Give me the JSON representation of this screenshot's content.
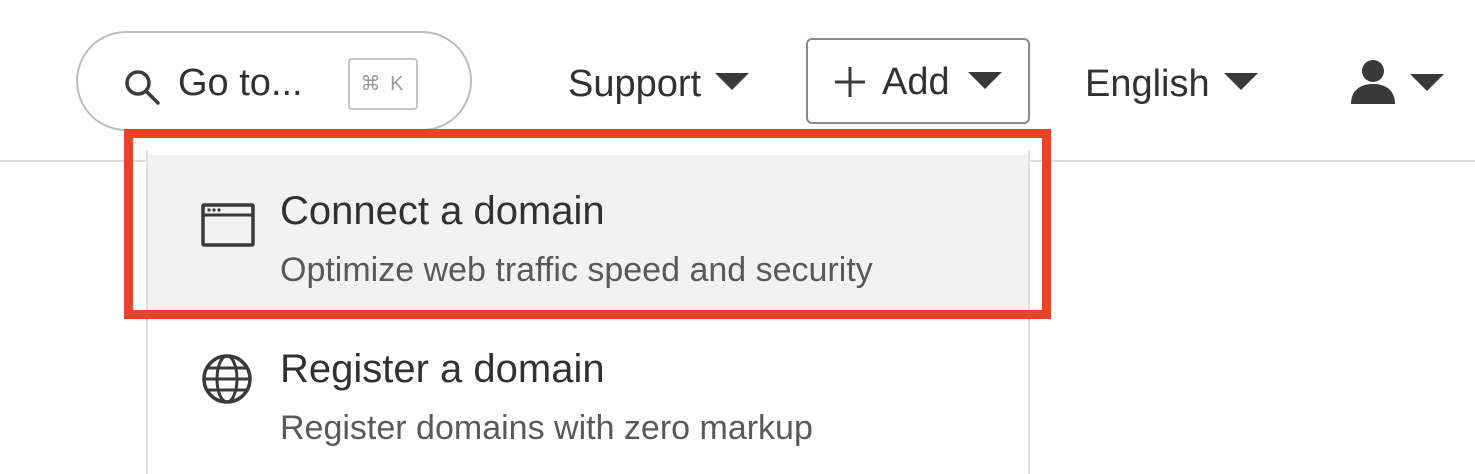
{
  "search": {
    "label": "Go to...",
    "shortcut": "⌘ K",
    "icon": "search-icon"
  },
  "nav": {
    "support_label": "Support",
    "add_label": "Add",
    "language_label": "English",
    "user_icon": "user-icon"
  },
  "menu": {
    "items": [
      {
        "title": "Connect a domain",
        "description": "Optimize web traffic speed and security",
        "icon": "browser-window-icon",
        "highlighted": true
      },
      {
        "title": "Register a domain",
        "description": "Register domains with zero markup",
        "icon": "globe-icon",
        "highlighted": false
      }
    ]
  },
  "colors": {
    "highlight_border": "#e8432a",
    "active_item_bg": "#f2f2f2",
    "text": "#313131",
    "muted_text": "#595959"
  }
}
